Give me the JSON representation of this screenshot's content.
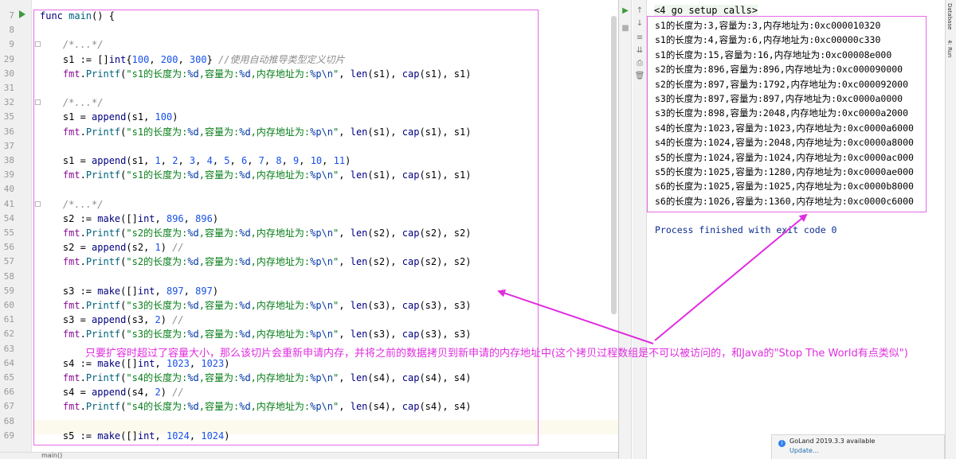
{
  "editor": {
    "line_numbers": [
      "7",
      "8",
      "9",
      "29",
      "30",
      "31",
      "32",
      "35",
      "36",
      "37",
      "38",
      "39",
      "40",
      "41",
      "54",
      "55",
      "56",
      "57",
      "58",
      "59",
      "60",
      "61",
      "62",
      "63",
      "64",
      "65",
      "66",
      "67",
      "68",
      "69"
    ],
    "breadcrumb": "main()",
    "lines": [
      [
        {
          "t": "func ",
          "c": "kw"
        },
        {
          "t": "main",
          "c": "fn"
        },
        {
          "t": "() {",
          "c": ""
        }
      ],
      [],
      [
        {
          "t": "    /*...*/",
          "c": "cmt"
        }
      ],
      [
        {
          "t": "    s1 := []",
          "c": ""
        },
        {
          "t": "int",
          "c": "kw"
        },
        {
          "t": "{",
          "c": ""
        },
        {
          "t": "100",
          "c": "num"
        },
        {
          "t": ", ",
          "c": ""
        },
        {
          "t": "200",
          "c": "num"
        },
        {
          "t": ", ",
          "c": ""
        },
        {
          "t": "300",
          "c": "num"
        },
        {
          "t": "} ",
          "c": ""
        },
        {
          "t": "//使用自动推导类型定义切片",
          "c": "cmt"
        }
      ],
      [
        {
          "t": "    fmt",
          "c": "pkg"
        },
        {
          "t": ".",
          "c": ""
        },
        {
          "t": "Printf",
          "c": "fn"
        },
        {
          "t": "(",
          "c": ""
        },
        {
          "t": "\"s1的长度为:",
          "c": "str"
        },
        {
          "t": "%d",
          "c": "fmt"
        },
        {
          "t": ",容量为:",
          "c": "str"
        },
        {
          "t": "%d",
          "c": "fmt"
        },
        {
          "t": ",内存地址为:",
          "c": "str"
        },
        {
          "t": "%p\\n",
          "c": "fmt"
        },
        {
          "t": "\"",
          "c": "str"
        },
        {
          "t": ", ",
          "c": ""
        },
        {
          "t": "len",
          "c": "kw"
        },
        {
          "t": "(s1), ",
          "c": ""
        },
        {
          "t": "cap",
          "c": "kw"
        },
        {
          "t": "(s1), s1)",
          "c": ""
        }
      ],
      [],
      [
        {
          "t": "    /*...*/",
          "c": "cmt"
        }
      ],
      [
        {
          "t": "    s1 = ",
          "c": ""
        },
        {
          "t": "append",
          "c": "kw"
        },
        {
          "t": "(s1, ",
          "c": ""
        },
        {
          "t": "100",
          "c": "num"
        },
        {
          "t": ")",
          "c": ""
        }
      ],
      [
        {
          "t": "    fmt",
          "c": "pkg"
        },
        {
          "t": ".",
          "c": ""
        },
        {
          "t": "Printf",
          "c": "fn"
        },
        {
          "t": "(",
          "c": ""
        },
        {
          "t": "\"s1的长度为:",
          "c": "str"
        },
        {
          "t": "%d",
          "c": "fmt"
        },
        {
          "t": ",容量为:",
          "c": "str"
        },
        {
          "t": "%d",
          "c": "fmt"
        },
        {
          "t": ",内存地址为:",
          "c": "str"
        },
        {
          "t": "%p\\n",
          "c": "fmt"
        },
        {
          "t": "\"",
          "c": "str"
        },
        {
          "t": ", ",
          "c": ""
        },
        {
          "t": "len",
          "c": "kw"
        },
        {
          "t": "(s1), ",
          "c": ""
        },
        {
          "t": "cap",
          "c": "kw"
        },
        {
          "t": "(s1), s1)",
          "c": ""
        }
      ],
      [],
      [
        {
          "t": "    s1 = ",
          "c": ""
        },
        {
          "t": "append",
          "c": "kw"
        },
        {
          "t": "(s1, ",
          "c": ""
        },
        {
          "t": "1",
          "c": "num"
        },
        {
          "t": ", ",
          "c": ""
        },
        {
          "t": "2",
          "c": "num"
        },
        {
          "t": ", ",
          "c": ""
        },
        {
          "t": "3",
          "c": "num"
        },
        {
          "t": ", ",
          "c": ""
        },
        {
          "t": "4",
          "c": "num"
        },
        {
          "t": ", ",
          "c": ""
        },
        {
          "t": "5",
          "c": "num"
        },
        {
          "t": ", ",
          "c": ""
        },
        {
          "t": "6",
          "c": "num"
        },
        {
          "t": ", ",
          "c": ""
        },
        {
          "t": "7",
          "c": "num"
        },
        {
          "t": ", ",
          "c": ""
        },
        {
          "t": "8",
          "c": "num"
        },
        {
          "t": ", ",
          "c": ""
        },
        {
          "t": "9",
          "c": "num"
        },
        {
          "t": ", ",
          "c": ""
        },
        {
          "t": "10",
          "c": "num"
        },
        {
          "t": ", ",
          "c": ""
        },
        {
          "t": "11",
          "c": "num"
        },
        {
          "t": ")",
          "c": ""
        }
      ],
      [
        {
          "t": "    fmt",
          "c": "pkg"
        },
        {
          "t": ".",
          "c": ""
        },
        {
          "t": "Printf",
          "c": "fn"
        },
        {
          "t": "(",
          "c": ""
        },
        {
          "t": "\"s1的长度为:",
          "c": "str"
        },
        {
          "t": "%d",
          "c": "fmt"
        },
        {
          "t": ",容量为:",
          "c": "str"
        },
        {
          "t": "%d",
          "c": "fmt"
        },
        {
          "t": ",内存地址为:",
          "c": "str"
        },
        {
          "t": "%p\\n",
          "c": "fmt"
        },
        {
          "t": "\"",
          "c": "str"
        },
        {
          "t": ", ",
          "c": ""
        },
        {
          "t": "len",
          "c": "kw"
        },
        {
          "t": "(s1), ",
          "c": ""
        },
        {
          "t": "cap",
          "c": "kw"
        },
        {
          "t": "(s1), s1)",
          "c": ""
        }
      ],
      [],
      [
        {
          "t": "    /*...*/",
          "c": "cmt"
        }
      ],
      [
        {
          "t": "    s2 := ",
          "c": ""
        },
        {
          "t": "make",
          "c": "kw"
        },
        {
          "t": "([]",
          "c": ""
        },
        {
          "t": "int",
          "c": "kw"
        },
        {
          "t": ", ",
          "c": ""
        },
        {
          "t": "896",
          "c": "num"
        },
        {
          "t": ", ",
          "c": ""
        },
        {
          "t": "896",
          "c": "num"
        },
        {
          "t": ")",
          "c": ""
        }
      ],
      [
        {
          "t": "    fmt",
          "c": "pkg"
        },
        {
          "t": ".",
          "c": ""
        },
        {
          "t": "Printf",
          "c": "fn"
        },
        {
          "t": "(",
          "c": ""
        },
        {
          "t": "\"s2的长度为:",
          "c": "str"
        },
        {
          "t": "%d",
          "c": "fmt"
        },
        {
          "t": ",容量为:",
          "c": "str"
        },
        {
          "t": "%d",
          "c": "fmt"
        },
        {
          "t": ",内存地址为:",
          "c": "str"
        },
        {
          "t": "%p\\n",
          "c": "fmt"
        },
        {
          "t": "\"",
          "c": "str"
        },
        {
          "t": ", ",
          "c": ""
        },
        {
          "t": "len",
          "c": "kw"
        },
        {
          "t": "(s2), ",
          "c": ""
        },
        {
          "t": "cap",
          "c": "kw"
        },
        {
          "t": "(s2), s2)",
          "c": ""
        }
      ],
      [
        {
          "t": "    s2 = ",
          "c": ""
        },
        {
          "t": "append",
          "c": "kw"
        },
        {
          "t": "(s2, ",
          "c": ""
        },
        {
          "t": "1",
          "c": "num"
        },
        {
          "t": ") ",
          "c": ""
        },
        {
          "t": "//",
          "c": "cmt"
        }
      ],
      [
        {
          "t": "    fmt",
          "c": "pkg"
        },
        {
          "t": ".",
          "c": ""
        },
        {
          "t": "Printf",
          "c": "fn"
        },
        {
          "t": "(",
          "c": ""
        },
        {
          "t": "\"s2的长度为:",
          "c": "str"
        },
        {
          "t": "%d",
          "c": "fmt"
        },
        {
          "t": ",容量为:",
          "c": "str"
        },
        {
          "t": "%d",
          "c": "fmt"
        },
        {
          "t": ",内存地址为:",
          "c": "str"
        },
        {
          "t": "%p\\n",
          "c": "fmt"
        },
        {
          "t": "\"",
          "c": "str"
        },
        {
          "t": ", ",
          "c": ""
        },
        {
          "t": "len",
          "c": "kw"
        },
        {
          "t": "(s2), ",
          "c": ""
        },
        {
          "t": "cap",
          "c": "kw"
        },
        {
          "t": "(s2), s2)",
          "c": ""
        }
      ],
      [],
      [
        {
          "t": "    s3 := ",
          "c": ""
        },
        {
          "t": "make",
          "c": "kw"
        },
        {
          "t": "([]",
          "c": ""
        },
        {
          "t": "int",
          "c": "kw"
        },
        {
          "t": ", ",
          "c": ""
        },
        {
          "t": "897",
          "c": "num"
        },
        {
          "t": ", ",
          "c": ""
        },
        {
          "t": "897",
          "c": "num"
        },
        {
          "t": ")",
          "c": ""
        }
      ],
      [
        {
          "t": "    fmt",
          "c": "pkg"
        },
        {
          "t": ".",
          "c": ""
        },
        {
          "t": "Printf",
          "c": "fn"
        },
        {
          "t": "(",
          "c": ""
        },
        {
          "t": "\"s3的长度为:",
          "c": "str"
        },
        {
          "t": "%d",
          "c": "fmt"
        },
        {
          "t": ",容量为:",
          "c": "str"
        },
        {
          "t": "%d",
          "c": "fmt"
        },
        {
          "t": ",内存地址为:",
          "c": "str"
        },
        {
          "t": "%p\\n",
          "c": "fmt"
        },
        {
          "t": "\"",
          "c": "str"
        },
        {
          "t": ", ",
          "c": ""
        },
        {
          "t": "len",
          "c": "kw"
        },
        {
          "t": "(s3), ",
          "c": ""
        },
        {
          "t": "cap",
          "c": "kw"
        },
        {
          "t": "(s3), s3)",
          "c": ""
        }
      ],
      [
        {
          "t": "    s3 = ",
          "c": ""
        },
        {
          "t": "append",
          "c": "kw"
        },
        {
          "t": "(s3, ",
          "c": ""
        },
        {
          "t": "2",
          "c": "num"
        },
        {
          "t": ") ",
          "c": ""
        },
        {
          "t": "//",
          "c": "cmt"
        }
      ],
      [
        {
          "t": "    fmt",
          "c": "pkg"
        },
        {
          "t": ".",
          "c": ""
        },
        {
          "t": "Printf",
          "c": "fn"
        },
        {
          "t": "(",
          "c": ""
        },
        {
          "t": "\"s3的长度为:",
          "c": "str"
        },
        {
          "t": "%d",
          "c": "fmt"
        },
        {
          "t": ",容量为:",
          "c": "str"
        },
        {
          "t": "%d",
          "c": "fmt"
        },
        {
          "t": ",内存地址为:",
          "c": "str"
        },
        {
          "t": "%p\\n",
          "c": "fmt"
        },
        {
          "t": "\"",
          "c": "str"
        },
        {
          "t": ", ",
          "c": ""
        },
        {
          "t": "len",
          "c": "kw"
        },
        {
          "t": "(s3), ",
          "c": ""
        },
        {
          "t": "cap",
          "c": "kw"
        },
        {
          "t": "(s3), s3)",
          "c": ""
        }
      ],
      [],
      [
        {
          "t": "    s4 := ",
          "c": ""
        },
        {
          "t": "make",
          "c": "kw"
        },
        {
          "t": "([]",
          "c": ""
        },
        {
          "t": "int",
          "c": "kw"
        },
        {
          "t": ", ",
          "c": ""
        },
        {
          "t": "1023",
          "c": "num"
        },
        {
          "t": ", ",
          "c": ""
        },
        {
          "t": "1023",
          "c": "num"
        },
        {
          "t": ")",
          "c": ""
        }
      ],
      [
        {
          "t": "    fmt",
          "c": "pkg"
        },
        {
          "t": ".",
          "c": ""
        },
        {
          "t": "Printf",
          "c": "fn"
        },
        {
          "t": "(",
          "c": ""
        },
        {
          "t": "\"s4的长度为:",
          "c": "str"
        },
        {
          "t": "%d",
          "c": "fmt"
        },
        {
          "t": ",容量为:",
          "c": "str"
        },
        {
          "t": "%d",
          "c": "fmt"
        },
        {
          "t": ",内存地址为:",
          "c": "str"
        },
        {
          "t": "%p\\n",
          "c": "fmt"
        },
        {
          "t": "\"",
          "c": "str"
        },
        {
          "t": ", ",
          "c": ""
        },
        {
          "t": "len",
          "c": "kw"
        },
        {
          "t": "(s4), ",
          "c": ""
        },
        {
          "t": "cap",
          "c": "kw"
        },
        {
          "t": "(s4), s4)",
          "c": ""
        }
      ],
      [
        {
          "t": "    s4 = ",
          "c": ""
        },
        {
          "t": "append",
          "c": "kw"
        },
        {
          "t": "(s4, ",
          "c": ""
        },
        {
          "t": "2",
          "c": "num"
        },
        {
          "t": ") ",
          "c": ""
        },
        {
          "t": "//",
          "c": "cmt"
        }
      ],
      [
        {
          "t": "    fmt",
          "c": "pkg"
        },
        {
          "t": ".",
          "c": ""
        },
        {
          "t": "Printf",
          "c": "fn"
        },
        {
          "t": "(",
          "c": ""
        },
        {
          "t": "\"s4的长度为:",
          "c": "str"
        },
        {
          "t": "%d",
          "c": "fmt"
        },
        {
          "t": ",容量为:",
          "c": "str"
        },
        {
          "t": "%d",
          "c": "fmt"
        },
        {
          "t": ",内存地址为:",
          "c": "str"
        },
        {
          "t": "%p\\n",
          "c": "fmt"
        },
        {
          "t": "\"",
          "c": "str"
        },
        {
          "t": ", ",
          "c": ""
        },
        {
          "t": "len",
          "c": "kw"
        },
        {
          "t": "(s4), ",
          "c": ""
        },
        {
          "t": "cap",
          "c": "kw"
        },
        {
          "t": "(s4), s4)",
          "c": ""
        }
      ],
      [],
      [
        {
          "t": "    s5 := ",
          "c": ""
        },
        {
          "t": "make",
          "c": "kw"
        },
        {
          "t": "([]",
          "c": ""
        },
        {
          "t": "int",
          "c": "kw"
        },
        {
          "t": ", ",
          "c": ""
        },
        {
          "t": "1024",
          "c": "num"
        },
        {
          "t": ", ",
          "c": ""
        },
        {
          "t": "1024",
          "c": "num"
        },
        {
          "t": ")",
          "c": ""
        }
      ]
    ]
  },
  "run": {
    "header": "<4 go setup calls>",
    "output": [
      "s1的长度为:3,容量为:3,内存地址为:0xc000010320",
      "s1的长度为:4,容量为:6,内存地址为:0xc00000c330",
      "s1的长度为:15,容量为:16,内存地址为:0xc00008e000",
      "s2的长度为:896,容量为:896,内存地址为:0xc000090000",
      "s2的长度为:897,容量为:1792,内存地址为:0xc000092000",
      "s3的长度为:897,容量为:897,内存地址为:0xc0000a0000",
      "s3的长度为:898,容量为:2048,内存地址为:0xc0000a2000",
      "s4的长度为:1023,容量为:1023,内存地址为:0xc0000a6000",
      "s4的长度为:1024,容量为:2048,内存地址为:0xc0000a8000",
      "s5的长度为:1024,容量为:1024,内存地址为:0xc0000ac000",
      "s5的长度为:1025,容量为:1280,内存地址为:0xc0000ae000",
      "s6的长度为:1025,容量为:1025,内存地址为:0xc0000b8000",
      "s6的长度为:1026,容量为:1360,内存地址为:0xc0000c6000"
    ],
    "process_finished": "Process finished with exit code 0"
  },
  "annotation": {
    "text": "只要扩容时超过了容量大小，那么该切片会重新申请内存，并将之前的数据拷贝到新申请的内存地址中(这个拷贝过程数组是不可以被访问的，和Java的\"Stop The World有点类似\")",
    "color": "#e02ee0"
  },
  "side_tabs": {
    "database": "Database",
    "run": "4: Run"
  },
  "notification": {
    "title": "GoLand 2019.3.3 available",
    "link": "Update..."
  }
}
